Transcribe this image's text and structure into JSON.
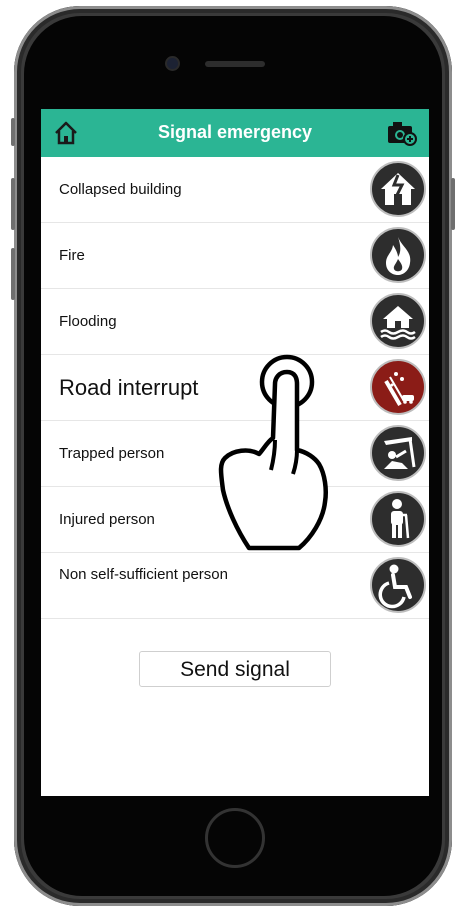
{
  "header": {
    "title": "Signal emergency"
  },
  "header_icons": {
    "home": "home-icon",
    "camera": "camera-add-icon"
  },
  "emergencies": [
    {
      "label": "Collapsed building",
      "icon": "collapsed-building-icon"
    },
    {
      "label": "Fire",
      "icon": "fire-icon"
    },
    {
      "label": "Flooding",
      "icon": "flooding-icon"
    },
    {
      "label": "Road interrupt",
      "icon": "road-interrupt-icon",
      "selected": true
    },
    {
      "label": "Trapped person",
      "icon": "trapped-person-icon"
    },
    {
      "label": "Injured person",
      "icon": "injured-person-icon"
    },
    {
      "label": "Non self-sufficient person",
      "icon": "wheelchair-icon"
    }
  ],
  "send_button": {
    "label": "Send signal"
  },
  "colors": {
    "header": "#2bb594",
    "icon_bg": "#2d2d2d",
    "selected_icon_bg": "#8b1c17"
  }
}
